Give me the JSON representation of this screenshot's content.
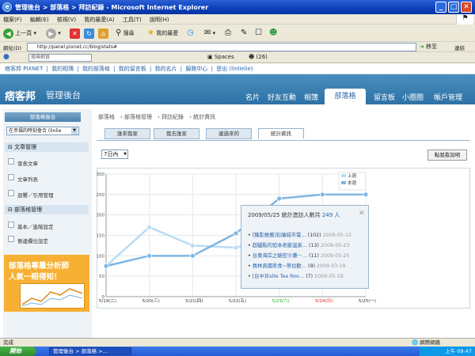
{
  "window": {
    "title": "管理後台 > 部落格 > 拜訪紀錄 - Microsoft Internet Explorer"
  },
  "menu": [
    "檔案(F)",
    "編輯(E)",
    "檢視(V)",
    "我的最愛(A)",
    "工具(T)",
    "說明(H)"
  ],
  "toolbar": {
    "back": "上一頁",
    "search": "搜尋",
    "favorites": "我的最愛"
  },
  "address": {
    "label": "網址(D)",
    "url": "http://panel.pixnet.cc/blog/stats#",
    "go": "移至",
    "links": "連結"
  },
  "gbar": {
    "search_placeholder": "搜尋網頁",
    "spaces": "Spaces",
    "count": "(26)"
  },
  "sitelinks": [
    "痞客邦 PIXNET",
    "|",
    "我的相簿",
    "|",
    "我的部落格",
    "|",
    "我的留言板",
    "|",
    "我的名片",
    "|",
    "服務中心",
    "|",
    "登出 (linlielie)"
  ],
  "header": {
    "logo": "痞客邦",
    "title": "管理後台",
    "nav": [
      "名片",
      "好友互動",
      "相簿",
      "部落格",
      "留言板",
      "小圈圈",
      "帳戶管理"
    ],
    "active": "部落格"
  },
  "sidebar": {
    "title": "部落格後台",
    "select_value": "在幸福的時刻會合 (linlie",
    "section1": "文章管理",
    "items1": [
      "發表文章",
      "文章列表",
      "迴響／引用管理"
    ],
    "section2": "部落格管理",
    "items2": [
      "基本／進階設定",
      "側邊欄位設定"
    ]
  },
  "ad": {
    "line1": "部落格專屬分析師",
    "line2": "人氣一眼得知！"
  },
  "breadcrumb": [
    "部落格",
    "部落格管理",
    "拜訪紀錄",
    "統計資訊"
  ],
  "tabs": [
    "誰來我家",
    "我去誰家",
    "連過來的",
    "統計資訊"
  ],
  "active_tab": "統計資訊",
  "range": "7日內",
  "help_button": "點我看說明",
  "chart_data": {
    "type": "line",
    "categories": [
      "5/19(二)",
      "5/20(三)",
      "5/21(四)",
      "5/22(五)",
      "5/23(六)",
      "5/24(日)",
      "5/25(一)"
    ],
    "ylim": [
      0,
      300
    ],
    "yticks": [
      0,
      50,
      100,
      150,
      200,
      250,
      300
    ],
    "grid": true,
    "legend_position": "top-right",
    "weekend_color": "#22aa22",
    "sunday_color": "#dd2222",
    "series": [
      {
        "name": "上週",
        "color": "#b8dcf2",
        "values": [
          75,
          170,
          125,
          120,
          150,
          170,
          170
        ]
      },
      {
        "name": "本週",
        "color": "#7fb6e2",
        "values": [
          75,
          100,
          100,
          155,
          240,
          250,
          250
        ]
      }
    ]
  },
  "popup": {
    "date": "2009/05/25",
    "label": "統計造訪人數共",
    "count": "249 人",
    "close": "✕",
    "rows": [
      {
        "title": "[獨影推薦]彩繪城市電…",
        "count": "(102)",
        "date": "2009-05-12"
      },
      {
        "title": "超驢點的如本老爺溫泉…",
        "count": "(13)",
        "date": "2009-05-23"
      },
      {
        "title": "台東海岸之驗密沙灘－…",
        "count": "(11)",
        "date": "2009-05-25"
      },
      {
        "title": "員林真國美食~蒂拉歡…",
        "count": "(9)",
        "date": "2009-03-19"
      },
      {
        "title": "[台中]Esite Tea Roo…",
        "count": "(7)",
        "date": "2009-05-18"
      }
    ]
  },
  "status": {
    "left": "完成",
    "right": "網際網路"
  },
  "taskbar": {
    "start": "開始",
    "task": "管理後台 > 部落格 >...",
    "time": "上午 09:47"
  }
}
